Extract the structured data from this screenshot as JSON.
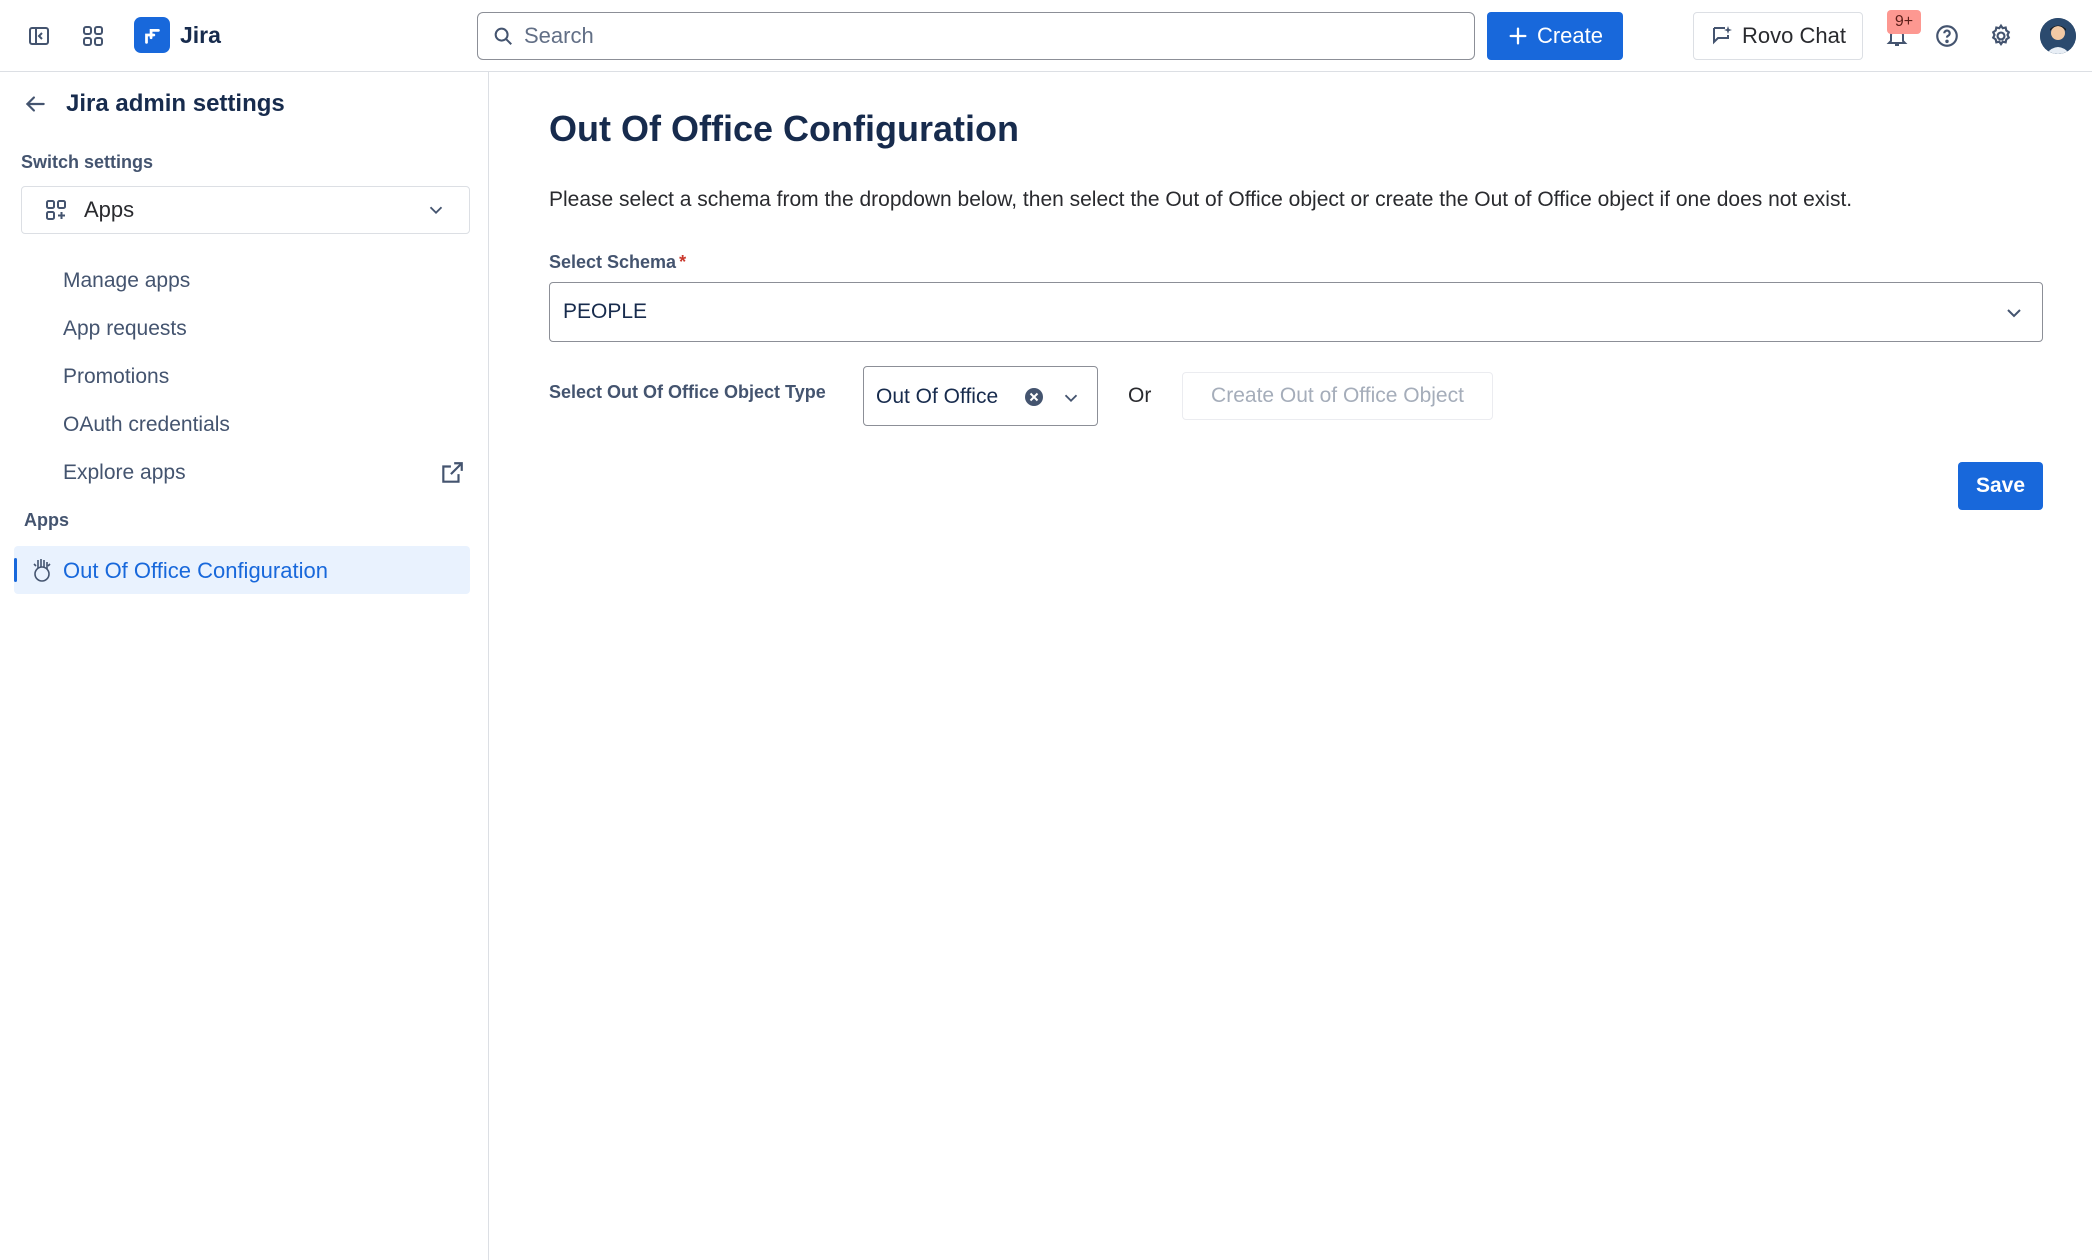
{
  "topnav": {
    "sidebar_toggle_icon": "sidebar-toggle-icon",
    "app_switcher_icon": "app-switcher-icon",
    "product_name": "Jira",
    "search": {
      "placeholder": "Search",
      "value": ""
    },
    "create_label": "Create",
    "rovo_label": "Rovo Chat",
    "notifications_badge": "9+",
    "help_icon": "help-icon",
    "settings_icon": "gear-icon"
  },
  "sidebar": {
    "back_title": "Jira admin settings",
    "switch_label": "Switch settings",
    "switch_value": "Apps",
    "items": [
      {
        "label": "Manage apps"
      },
      {
        "label": "App requests"
      },
      {
        "label": "Promotions"
      },
      {
        "label": "OAuth credentials"
      },
      {
        "label": "Explore apps",
        "external": true
      }
    ],
    "apps_section_label": "Apps",
    "active_item": "Out Of Office Configuration"
  },
  "main": {
    "title": "Out Of Office Configuration",
    "description": "Please select a schema from the dropdown below, then select the Out of Office object or create the Out of Office object if one does not exist.",
    "schema_label": "Select Schema",
    "schema_required_marker": "*",
    "schema_value": "PEOPLE",
    "type_label": "Select Out Of Office Object Type",
    "type_value": "Out Of Office",
    "or_text": "Or",
    "create_object_label": "Create Out of Office Object",
    "save_label": "Save"
  },
  "colors": {
    "brand": "#1868db",
    "active_bg": "#e9f2fe",
    "badge": "#fd9891",
    "required": "#c9372c"
  }
}
